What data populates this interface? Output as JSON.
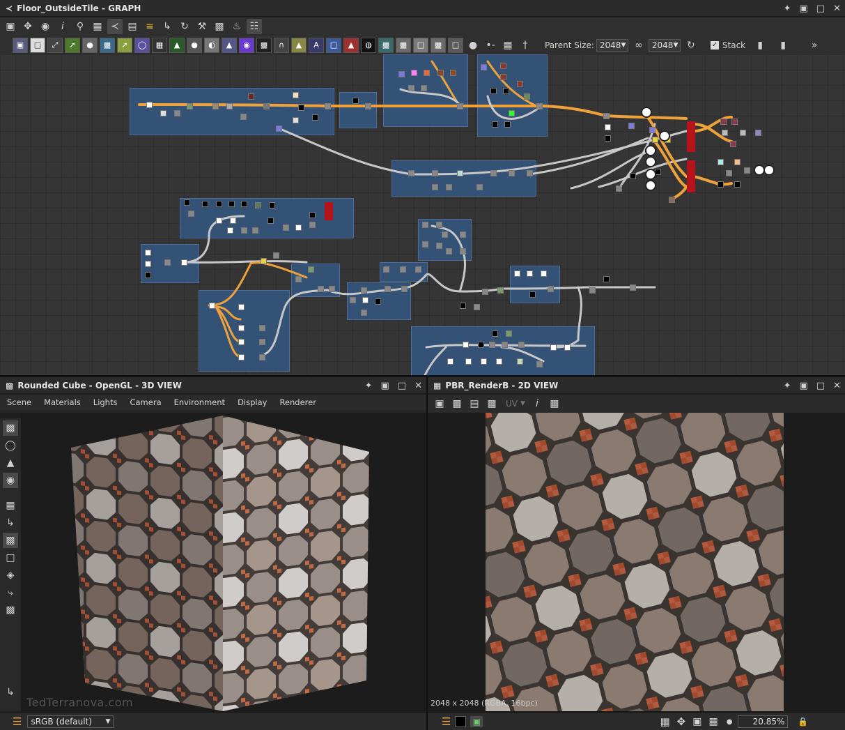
{
  "graph_panel": {
    "title": "Floor_OutsideTile - GRAPH",
    "toolbar_icons": [
      "fit-icon",
      "move-icon",
      "camera-icon",
      "info-icon",
      "search-icon",
      "frame-icon",
      "graph-icon",
      "layout-icon",
      "align-icon",
      "connect-icon",
      "refresh-icon",
      "settings-icon",
      "snapshot-icon",
      "clean-icon",
      "grid-icon"
    ],
    "parent_size_label": "Parent Size:",
    "parent_size_w": "2048",
    "parent_size_h": "2048",
    "stack_label": "Stack"
  },
  "view3d_panel": {
    "title": "Rounded Cube - OpenGL - 3D VIEW",
    "menu": [
      "Scene",
      "Materials",
      "Lights",
      "Camera",
      "Environment",
      "Display",
      "Renderer"
    ],
    "watermark": "TedTerranova.com",
    "colorspace": "sRGB (default)"
  },
  "view2d_panel": {
    "title": "PBR_RenderB - 2D VIEW",
    "uv_label": "UV",
    "status": "2048 x 2048 (RGBA, 16bpc)",
    "zoom": "20.85%"
  },
  "colors": {
    "frame": "#345680",
    "wire_orange": "#f0a23a",
    "wire_gray": "#c8c8c8",
    "output_red": "#b5141c"
  }
}
